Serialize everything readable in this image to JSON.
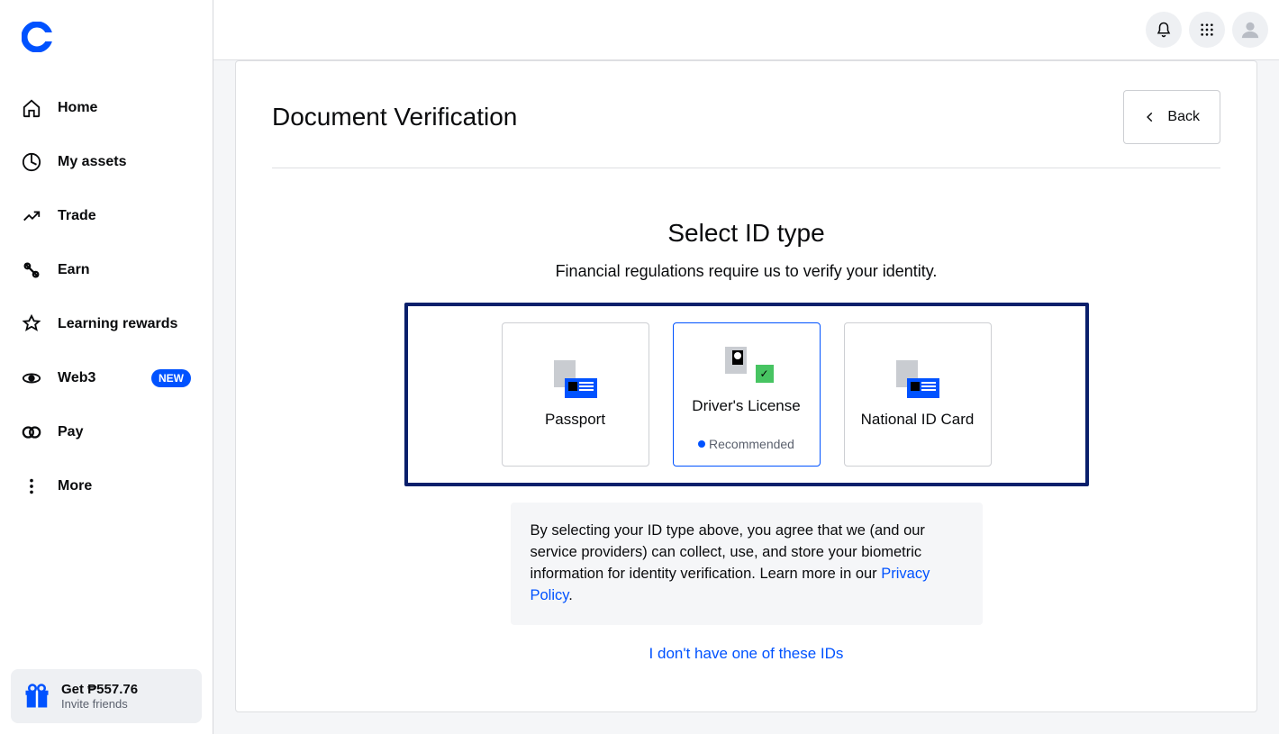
{
  "sidebar": {
    "items": [
      {
        "label": "Home"
      },
      {
        "label": "My assets"
      },
      {
        "label": "Trade"
      },
      {
        "label": "Earn"
      },
      {
        "label": "Learning rewards"
      },
      {
        "label": "Web3",
        "badge": "NEW"
      },
      {
        "label": "Pay"
      },
      {
        "label": "More"
      }
    ],
    "referral": {
      "title": "Get ₱557.76",
      "sub": "Invite friends"
    }
  },
  "header": {
    "back_label": "Back",
    "page_title": "Document Verification"
  },
  "select_id": {
    "title": "Select ID type",
    "subtitle": "Financial regulations require us to verify your identity.",
    "options": [
      {
        "label": "Passport"
      },
      {
        "label": "Driver's License",
        "recommended_label": "Recommended"
      },
      {
        "label": "National ID Card"
      }
    ],
    "consent_text_1": "By selecting your ID type above, you agree that we (and our service providers) can collect, use, and store your biometric information for identity verification. Learn more in our ",
    "consent_link": "Privacy Policy",
    "consent_text_2": ".",
    "alt_link": "I don't have one of these IDs"
  }
}
